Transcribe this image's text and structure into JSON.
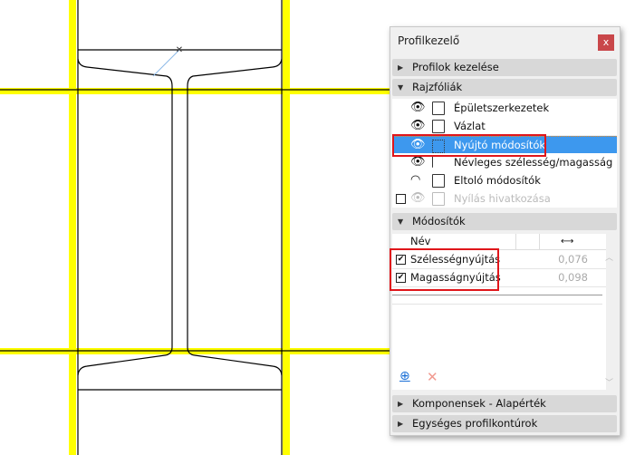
{
  "panel": {
    "title": "Profilkezelő",
    "close_label": "x",
    "sections": {
      "profiles": "Profilok kezelése",
      "layers": "Rajzfóliák",
      "modifiers": "Módosítók",
      "components": "Komponensek - Alapérték",
      "contours": "Egységes profilkontúrok"
    },
    "layers": [
      {
        "label": "Épületszerkezetek",
        "visible": true,
        "selected": false
      },
      {
        "label": "Vázlat",
        "visible": true,
        "selected": false
      },
      {
        "label": "Nyújtó módosítók",
        "visible": true,
        "selected": true
      },
      {
        "label": "Névleges szélesség/magasság",
        "visible": true,
        "selected": false
      },
      {
        "label": "Eltoló módosítók",
        "visible": true,
        "selected": false
      },
      {
        "label": "Nyílás hivatkozása",
        "visible": false,
        "selected": false
      }
    ],
    "table": {
      "col_name": "Név",
      "col_value_icon": "width-arrow-icon",
      "col_value_glyph": "⟷",
      "rows": [
        {
          "name": "Szélességnyújtás",
          "value": "0,076",
          "checked": true
        },
        {
          "name": "Magasságnyújtás",
          "value": "0,098",
          "checked": true
        }
      ]
    },
    "icons": {
      "add": "⊕",
      "delete": "✕"
    }
  },
  "colors": {
    "guide": "#ffff00",
    "selection": "#3d98ee",
    "highlight": "#e0161b"
  }
}
